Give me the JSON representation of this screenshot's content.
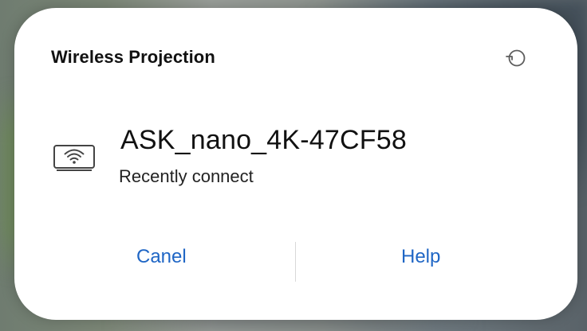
{
  "dialog": {
    "title": "Wireless Projection",
    "refresh_icon": "refresh-icon",
    "device": {
      "icon": "cast-wifi-icon",
      "name": "ASK_nano_4K-47CF58",
      "status": "Recently connect"
    },
    "buttons": {
      "cancel": "Canel",
      "help": "Help"
    }
  },
  "colors": {
    "dialog_background": "#ffffff",
    "title_text": "#111111",
    "action_text": "#1f66c5",
    "divider": "#d9d9d9"
  }
}
